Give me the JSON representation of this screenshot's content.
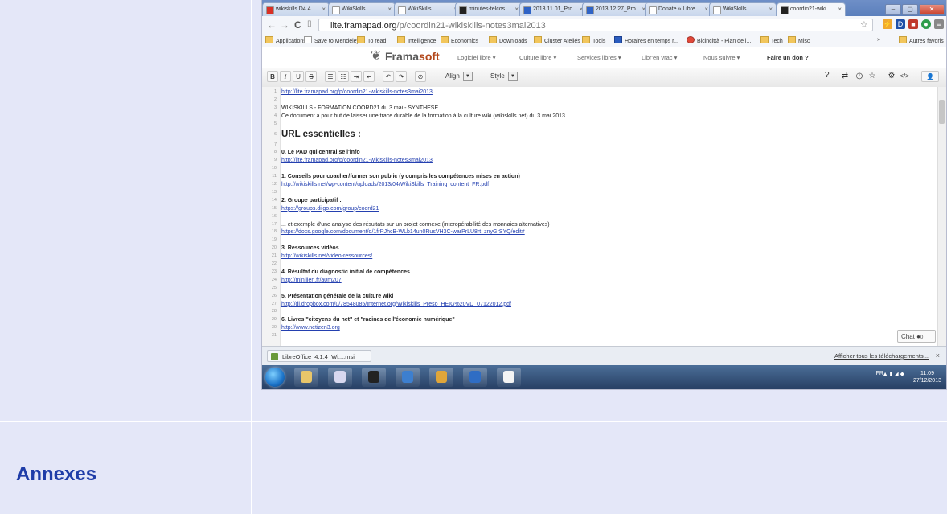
{
  "page": {
    "annexes_heading": "Annexes"
  },
  "browser": {
    "tabs": [
      {
        "label": "wikiskills D4.4",
        "favicon_color": "#d93025",
        "active": false
      },
      {
        "label": "WikiSkills",
        "favicon_color": "#ffffff",
        "active": false
      },
      {
        "label": "WikiSkills",
        "favicon_color": "#ffffff",
        "active": false
      },
      {
        "label": "minutes-telcos",
        "favicon_color": "#222222",
        "active": false
      },
      {
        "label": "2013.11.01_Pro",
        "favicon_color": "#2f63c6",
        "active": false
      },
      {
        "label": "2013.12.27_Pro",
        "favicon_color": "#2f63c6",
        "active": false
      },
      {
        "label": "Donate » Libre",
        "favicon_color": "#ffffff",
        "active": false
      },
      {
        "label": "WikiSkills",
        "favicon_color": "#ffffff",
        "active": false
      },
      {
        "label": "coordin21-wiki",
        "favicon_color": "#222222",
        "active": true
      }
    ],
    "url_host": "lite.framapad.org",
    "url_path": "/p/coordin21-wikiskills-notes3mai2013",
    "bookmarks": [
      {
        "label": "Applications",
        "icon": "apps-icon"
      },
      {
        "label": "Save to Mendeley",
        "icon": "page-icon"
      },
      {
        "label": "To read",
        "icon": "folder-icon"
      },
      {
        "label": "Intelligence",
        "icon": "folder-icon"
      },
      {
        "label": "Economics",
        "icon": "folder-icon"
      },
      {
        "label": "Downloads",
        "icon": "folder-icon"
      },
      {
        "label": "Cluster Ateliés",
        "icon": "folder-icon"
      },
      {
        "label": "Tools",
        "icon": "folder-icon"
      },
      {
        "label": "Horaires en temps r...",
        "icon": "blue-icon"
      },
      {
        "label": "Bicincittà - Plan de l...",
        "icon": "bike-icon"
      },
      {
        "label": "Tech",
        "icon": "folder-icon"
      },
      {
        "label": "Misc",
        "icon": "folder-icon"
      },
      {
        "label": "Autres favoris",
        "icon": "folder-icon"
      }
    ],
    "overflow_label": "»"
  },
  "framasoft": {
    "logo_a": "Frama",
    "logo_b": "soft",
    "menu": [
      {
        "label": "Logiciel libre ▾"
      },
      {
        "label": "Culture libre ▾"
      },
      {
        "label": "Services libres ▾"
      },
      {
        "label": "Libr'en vrac ▾"
      },
      {
        "label": "Nous suivre ▾"
      },
      {
        "label": "Faire un don ?"
      }
    ]
  },
  "toolbar": {
    "bold": "B",
    "italic": "I",
    "underline": "U",
    "strike": "S",
    "align_label": "Align",
    "style_label": "Style",
    "help": "?"
  },
  "editor": {
    "lines": [
      {
        "n": "1",
        "text": "http://lite.framapad.org/p/coordin21-wikiskills-notes3mai2013",
        "kind": "link"
      },
      {
        "n": "2",
        "text": "",
        "kind": "text"
      },
      {
        "n": "3",
        "text": "WIKISKILLS - FORMATION COORD21 du 3 mai - SYNTHESE",
        "kind": "text"
      },
      {
        "n": "4",
        "text": "Ce document a pour but de laisser une trace durable de la formation à la culture wiki (wikiskills.net) du 3 mai 2013.",
        "kind": "text"
      },
      {
        "n": "5",
        "text": "",
        "kind": "text"
      },
      {
        "n": "6",
        "text": "URL essentielles :",
        "kind": "heading"
      },
      {
        "n": "7",
        "text": "",
        "kind": "text"
      },
      {
        "n": "8",
        "text": "0. Le PAD qui centralise l'info",
        "kind": "bold"
      },
      {
        "n": "9",
        "text": "http://lite.framapad.org/p/coordin21-wikiskills-notes3mai2013",
        "kind": "link"
      },
      {
        "n": "10",
        "text": "",
        "kind": "text"
      },
      {
        "n": "11",
        "text": "1. Conseils pour coacher/former son public (y compris les compétences mises en action)",
        "kind": "bold"
      },
      {
        "n": "12",
        "text": "http://wikiskills.net/wp-content/uploads/2013/04/WikiSkills_Training_content_FR.pdf",
        "kind": "link"
      },
      {
        "n": "13",
        "text": "",
        "kind": "text"
      },
      {
        "n": "14",
        "text": "2. Groupe participatif :",
        "kind": "bold"
      },
      {
        "n": "15",
        "text": "https://groups.diigo.com/group/coord21",
        "kind": "link"
      },
      {
        "n": "16",
        "text": "",
        "kind": "text"
      },
      {
        "n": "17",
        "text": "... et exemple d'une analyse des résultats sur un projet connexe (interopérabilité des monnaies alternatives)",
        "kind": "text"
      },
      {
        "n": "18",
        "text": "https://docs.google.com/document/d/1frRJhcB-WLb14un0RusVH3C-warPrLU8rt_znyGrSYQ/edit#",
        "kind": "link"
      },
      {
        "n": "19",
        "text": "",
        "kind": "text"
      },
      {
        "n": "20",
        "text": "3. Ressources vidéos",
        "kind": "bold"
      },
      {
        "n": "21",
        "text": "http://wikiskills.net/video-ressources/",
        "kind": "link"
      },
      {
        "n": "22",
        "text": "",
        "kind": "text"
      },
      {
        "n": "23",
        "text": "4. Résultat du diagnostic initial de compétences",
        "kind": "bold"
      },
      {
        "n": "24",
        "text": "http://minilien.fr/a0m207",
        "kind": "link"
      },
      {
        "n": "25",
        "text": "",
        "kind": "text"
      },
      {
        "n": "26",
        "text": "5. Présentation générale de la culture wiki",
        "kind": "bold"
      },
      {
        "n": "27",
        "text": "http://dl.dropbox.com/u/78548085/Internet.org/Wikiskills_Preso_HEIG%20VD_07122012.pdf",
        "kind": "link"
      },
      {
        "n": "28",
        "text": "",
        "kind": "text"
      },
      {
        "n": "29",
        "text": "6. Livres \"citoyens du net\" et \"racines de l'économie numérique\"",
        "kind": "bold"
      },
      {
        "n": "30",
        "text": "http://www.netizen3.org",
        "kind": "link"
      },
      {
        "n": "31",
        "text": "",
        "kind": "text"
      }
    ],
    "chat_label": "Chat",
    "chat_count": "0"
  },
  "downloads": {
    "file": "LibreOffice_4.1.4_Wi....msi",
    "show_all": "Afficher tous les téléchargements...",
    "close": "×"
  },
  "taskbar": {
    "lang": "FR",
    "time": "11:09",
    "date": "27/12/2013",
    "apps": [
      {
        "name": "explorer",
        "color": "#e8c66a"
      },
      {
        "name": "app-grid",
        "color": "#d8d8ef"
      },
      {
        "name": "circle-app",
        "color": "#222222"
      },
      {
        "name": "mail",
        "color": "#3d7fcf"
      },
      {
        "name": "chrome",
        "color": "#e0a63a"
      },
      {
        "name": "writer",
        "color": "#2f6dc4"
      },
      {
        "name": "document",
        "color": "#f4f4f4"
      }
    ]
  }
}
